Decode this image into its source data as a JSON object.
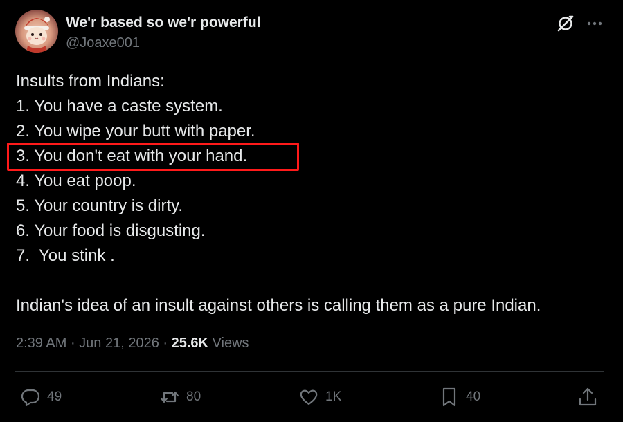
{
  "author": {
    "display_name": "We'r based so we'r powerful",
    "handle": "@Joaxe001",
    "avatar_icon": "cat-in-santa-hat-avatar"
  },
  "header_icons": {
    "grok": "grok-icon",
    "more": "more-icon"
  },
  "body": {
    "lines": [
      "Insults from Indians:",
      "1. You have a caste system.",
      "2. You wipe your butt with paper.",
      "3. You don't eat with your hand.",
      "4. You eat poop.",
      "5. Your country is dirty.",
      "6. Your food is disgusting.",
      "7.  You stink ."
    ],
    "closing": "Indian's idea of an insult against others is calling them as a pure Indian."
  },
  "highlight": {
    "line_index": 3,
    "color": "#ff1a1a"
  },
  "meta": {
    "time": "2:39 AM",
    "separator": " · ",
    "date": "Jun 21, 2026",
    "views_count": "25.6K",
    "views_label": "Views"
  },
  "actions": {
    "reply_count": "49",
    "retweet_count": "80",
    "like_count": "1K",
    "bookmark_count": "40"
  },
  "colors": {
    "background": "#000000",
    "text": "#e7e9ea",
    "muted": "#71767b",
    "divider": "#2f3336"
  }
}
